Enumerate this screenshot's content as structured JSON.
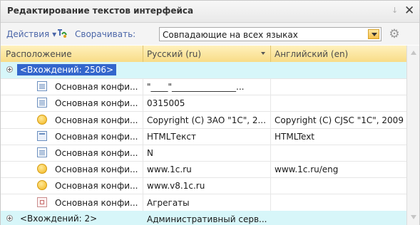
{
  "window": {
    "title": "Редактирование текстов интерфейса"
  },
  "toolbar": {
    "actions_label": "Действия",
    "collapse_label": "Сворачивать:",
    "collapse_value": "Совпадающие на всех языках"
  },
  "table": {
    "columns": [
      "Расположение",
      "Русский (ru)",
      "Английский (en)"
    ],
    "rows": [
      {
        "type": "group",
        "location": "<Вхождений: 2506>",
        "ru": "",
        "en": "",
        "selected": true
      },
      {
        "type": "item",
        "icon": "document-icon",
        "location": "Основная конфи...",
        "ru": "\"____\"_______________...",
        "en": ""
      },
      {
        "type": "item",
        "icon": "document-icon",
        "location": "Основная конфи...",
        "ru": "0315005",
        "en": ""
      },
      {
        "type": "item",
        "icon": "circle-icon",
        "location": "Основная конфи...",
        "ru": "Copyright (C) ЗАО \"1С\", 2...",
        "en": "Copyright (C) CJSC \"1C\", 2009"
      },
      {
        "type": "item",
        "icon": "form-icon",
        "location": "Основная конфи...",
        "ru": "HTMLТекст",
        "en": "HTMLText"
      },
      {
        "type": "item",
        "icon": "document-icon",
        "location": "Основная конфи...",
        "ru": "N",
        "en": ""
      },
      {
        "type": "item",
        "icon": "circle-icon",
        "location": "Основная конфи...",
        "ru": "www.1c.ru",
        "en": "www.1c.ru/eng"
      },
      {
        "type": "item",
        "icon": "circle-icon",
        "location": "Основная конфи...",
        "ru": "www.v8.1c.ru",
        "en": ""
      },
      {
        "type": "item",
        "icon": "aggregate-icon",
        "location": "Основная конфи...",
        "ru": "Агрегаты",
        "en": ""
      },
      {
        "type": "group",
        "location": "<Вхождений: 2>",
        "ru": "Административный серв...",
        "en": "",
        "selected": false
      }
    ]
  }
}
